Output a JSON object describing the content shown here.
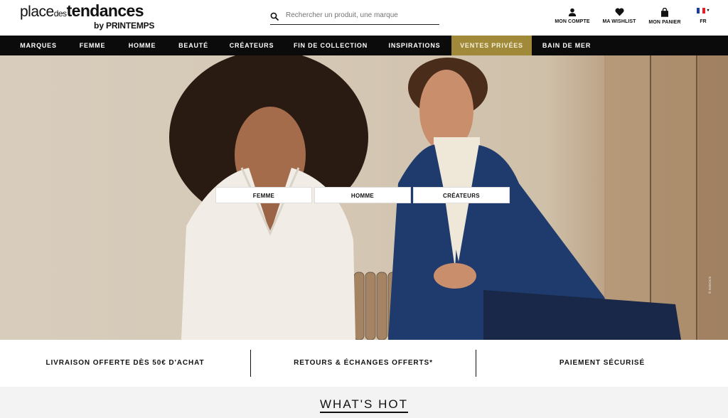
{
  "header": {
    "logo": {
      "part1": "place",
      "part2": "des",
      "part3": "tendances",
      "by": "by",
      "brand": "PRINTEMPS"
    },
    "search": {
      "placeholder": "Rechercher un produit, une marque",
      "icon": "search-icon"
    },
    "actions": [
      {
        "label": "MON COMPTE",
        "icon": "user-icon"
      },
      {
        "label": "MA WISHLIST",
        "icon": "heart-icon"
      },
      {
        "label": "MON PANIER",
        "icon": "bag-icon"
      }
    ],
    "language": {
      "code": "FR",
      "icon": "france-flag-icon"
    }
  },
  "nav": {
    "items": [
      {
        "label": "MARQUES"
      },
      {
        "label": "FEMME"
      },
      {
        "label": "HOMME"
      },
      {
        "label": "BEAUTÉ"
      },
      {
        "label": "CRÉATEURS"
      },
      {
        "label": "FIN DE COLLECTION"
      },
      {
        "label": "INSPIRATIONS"
      },
      {
        "label": "VENTES PRIVÉES"
      },
      {
        "label": "BAIN DE MER"
      }
    ],
    "highlight_color": "#a08a3a"
  },
  "hero": {
    "buttons": [
      {
        "label": "FEMME"
      },
      {
        "label": "HOMME"
      },
      {
        "label": "CRÉATEURS"
      }
    ],
    "copyright": "© SODOCS"
  },
  "usp": {
    "items": [
      {
        "label": "LIVRAISON OFFERTE DÈS 50€ D'ACHAT"
      },
      {
        "label": "RETOURS & ÉCHANGES OFFERTS*"
      },
      {
        "label": "PAIEMENT SÉCURISÉ"
      }
    ]
  },
  "section": {
    "title": "WHAT'S HOT"
  }
}
